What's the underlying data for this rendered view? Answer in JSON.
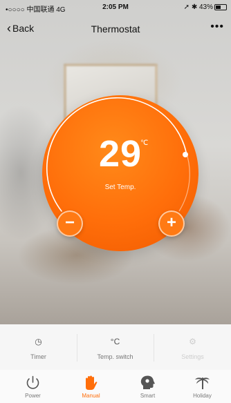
{
  "status_bar": {
    "carrier": "•○○○○ 中国联通  4G",
    "time": "2:05 PM",
    "right": "➚ ✱ 43%"
  },
  "nav": {
    "back_label": "Back",
    "title": "Thermostat",
    "more_label": "•••"
  },
  "dial": {
    "temperature": "29",
    "unit": "℃",
    "label": "Set Temp.",
    "minus_label": "−",
    "plus_label": "+"
  },
  "quick_actions": [
    {
      "label": "Timer",
      "icon": "clock-icon",
      "glyph": "◷"
    },
    {
      "label": "Temp. switch",
      "icon": "celsius-icon",
      "glyph": "°C"
    },
    {
      "label": "Settings",
      "icon": "gear-icon",
      "glyph": "⚙"
    }
  ],
  "tabs": [
    {
      "label": "Power",
      "icon": "power-icon"
    },
    {
      "label": "Manual",
      "icon": "hand-icon",
      "active": true
    },
    {
      "label": "Smart",
      "icon": "smart-head-icon"
    },
    {
      "label": "Holiday",
      "icon": "holiday-icon"
    }
  ],
  "colors": {
    "accent": "#ff6e0a",
    "dial": "#ff7a14"
  }
}
